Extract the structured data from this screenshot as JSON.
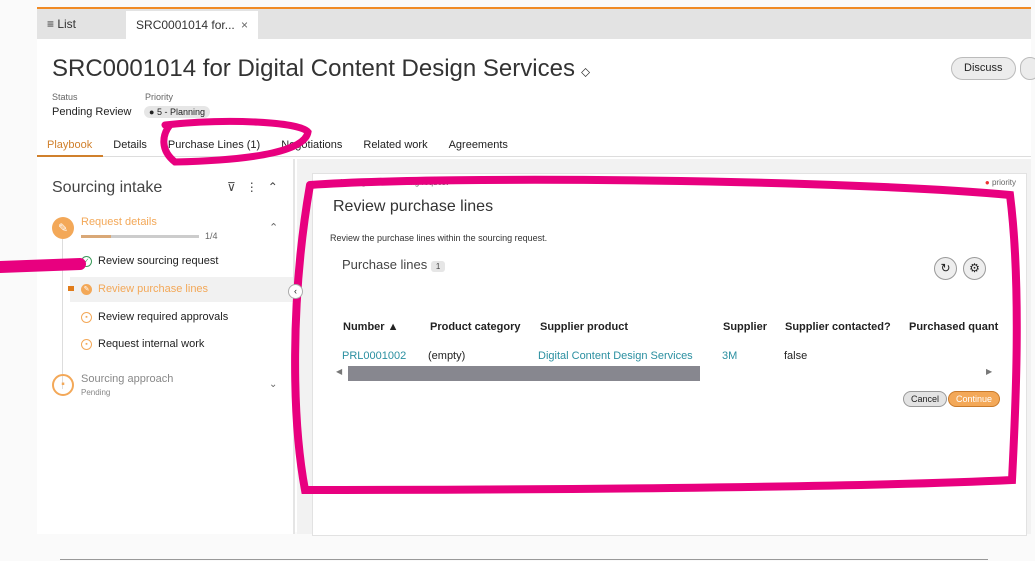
{
  "tabs": {
    "list": "List",
    "record": "SRC0001014 for...",
    "close": "×"
  },
  "header": {
    "title": "SRC0001014 for Digital Content Design Services",
    "status_label": "Status",
    "status": "Pending Review",
    "priority_label": "Priority",
    "priority": "5 - Planning",
    "discuss": "Discuss"
  },
  "nav": [
    "Playbook",
    "Details",
    "Purchase Lines (1)",
    "Negotiations",
    "Related work",
    "Agreements"
  ],
  "sidebar": {
    "title": "Sourcing intake",
    "group1": {
      "label": "Request details",
      "progress": "1/4",
      "progress_value": 0.25
    },
    "steps": [
      "Review sourcing request",
      "Review purchase lines",
      "Review required approvals",
      "Request internal work"
    ],
    "group2": {
      "label": "Sourcing approach",
      "sub": "Pending"
    }
  },
  "card": {
    "state": "In Progress",
    "context": "Sourcing request",
    "priority": "priority",
    "title": "Review purchase lines",
    "desc": "Review the purchase lines within the sourcing request.",
    "list_title": "Purchase lines",
    "count": "1",
    "columns": [
      "Number ▲",
      "Product category",
      "Supplier product",
      "Supplier",
      "Supplier contacted?",
      "Purchased quant"
    ],
    "row": [
      "PRL0001002",
      "(empty)",
      "Digital Content Design Services",
      "3M",
      "false"
    ],
    "cancel": "Cancel",
    "continue": "Continue"
  },
  "colors": {
    "accent": "#f08a24",
    "link": "#2a8fa0",
    "annotation": "#e8007f"
  }
}
